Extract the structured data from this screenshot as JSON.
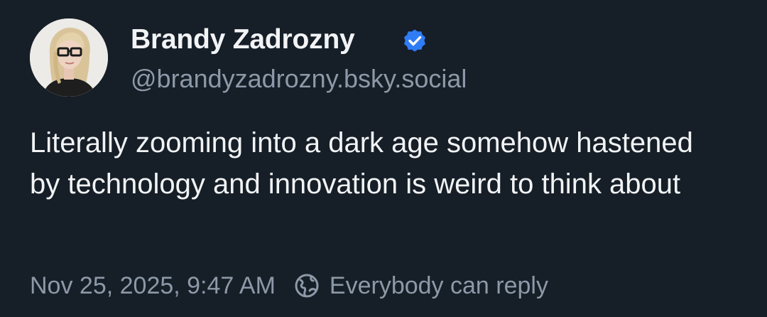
{
  "post": {
    "author": {
      "display_name": "Brandy Zadrozny",
      "handle": "@brandyzadrozny.bsky.social",
      "verified": true,
      "avatar_icon": "profile-photo"
    },
    "text": "Literally zooming into a dark age somehow hastened by technology and innovation is weird to think about",
    "timestamp": "Nov 25, 2025, 9:47 AM",
    "reply_setting": {
      "label": "Everybody can reply",
      "icon": "globe-icon"
    }
  },
  "colors": {
    "background": "#161e27",
    "primary_text": "#f1f3f5",
    "secondary_text": "#8d99a8",
    "verified_badge": "#2f7cf6"
  }
}
